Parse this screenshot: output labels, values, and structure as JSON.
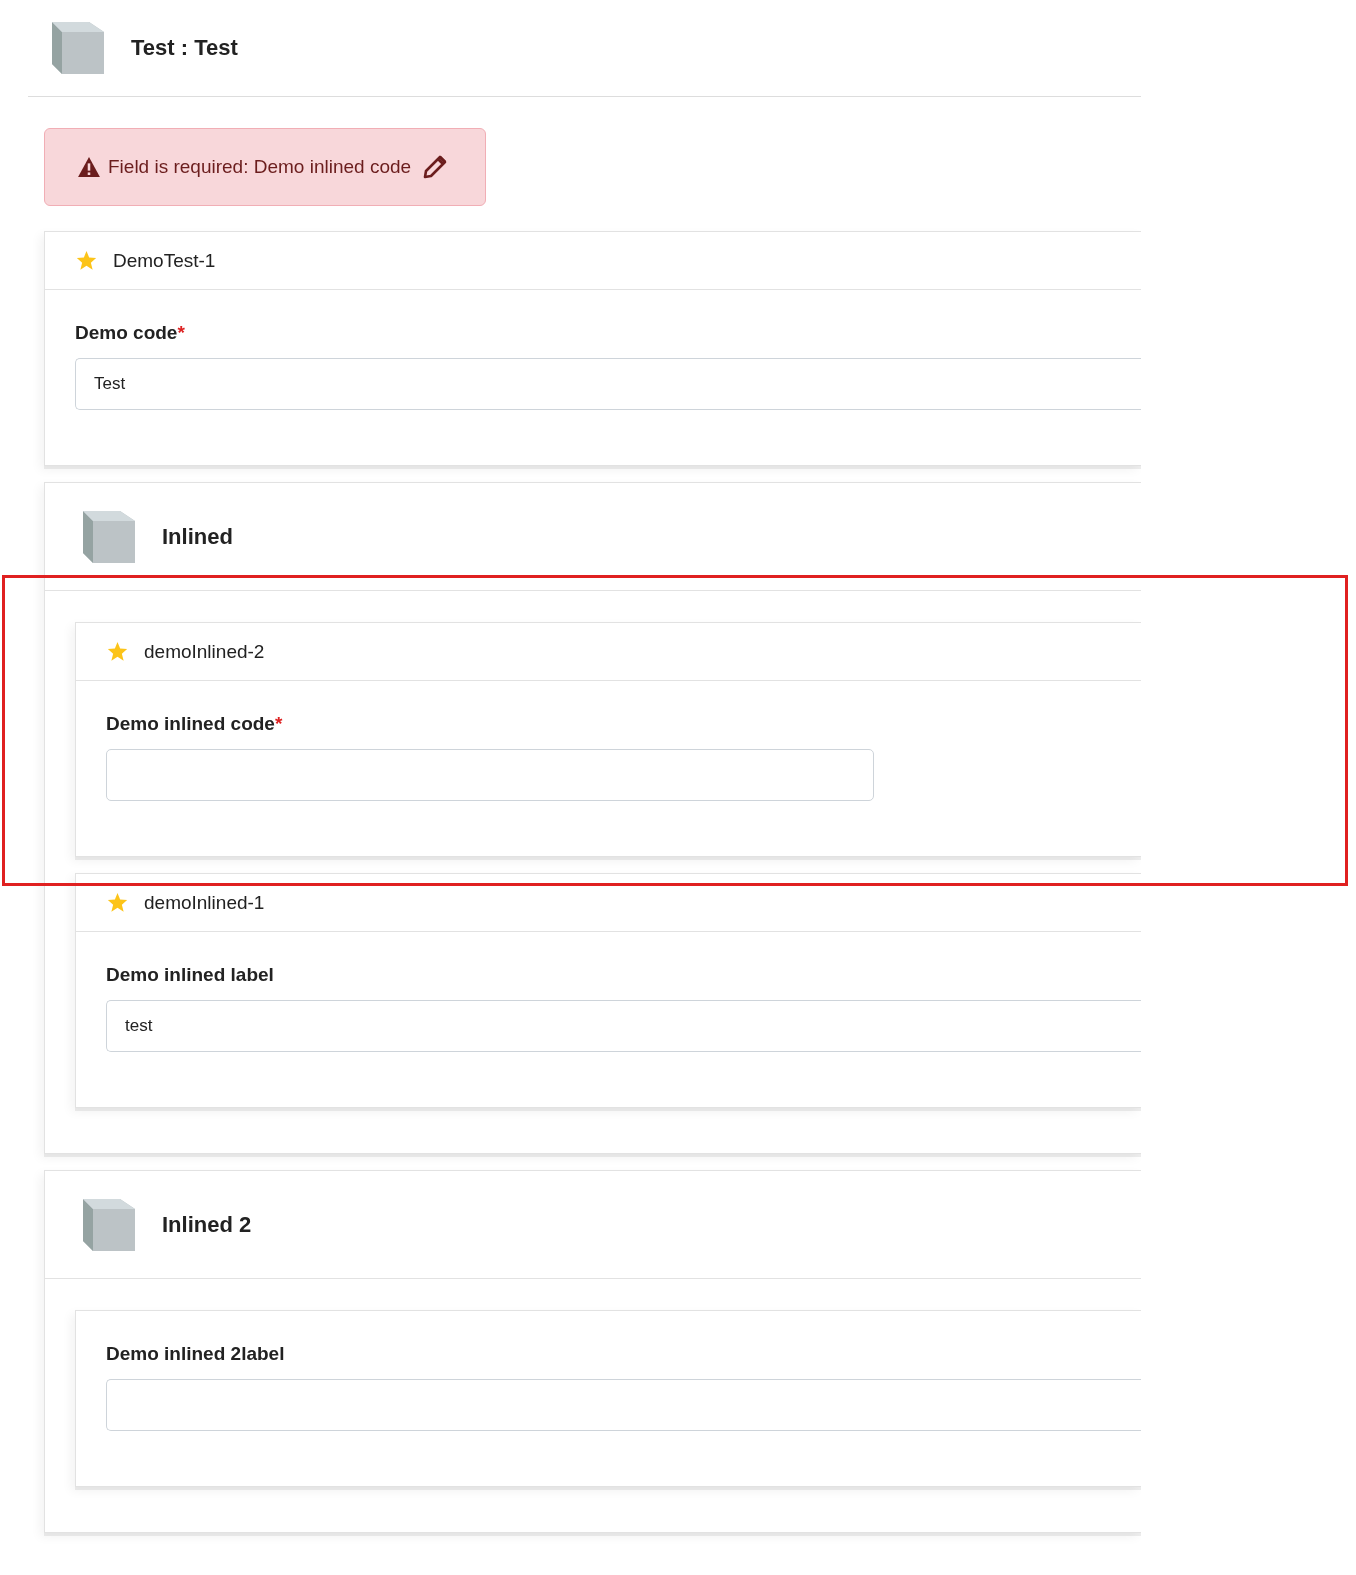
{
  "header": {
    "title": "Test : Test"
  },
  "alert": {
    "message": "Field is required: Demo inlined code"
  },
  "record": {
    "title": "DemoTest-1",
    "fields": [
      {
        "label": "Demo code",
        "marker": "*",
        "value": "Test",
        "kind": "wide"
      }
    ]
  },
  "sections": [
    {
      "title": "Inlined",
      "items": [
        {
          "title": "demoInlined-2",
          "fields": [
            {
              "label": "Demo inlined code",
              "marker": "*",
              "kind": "short"
            }
          ]
        },
        {
          "title": "demoInlined-1",
          "fields": [
            {
              "label": "Demo inlined label",
              "value": "test",
              "kind": "wide"
            }
          ]
        }
      ]
    },
    {
      "title": "Inlined 2",
      "items": [
        {
          "fields": [
            {
              "label": "Demo inlined 2label",
              "kind": "wide"
            }
          ]
        }
      ]
    }
  ]
}
